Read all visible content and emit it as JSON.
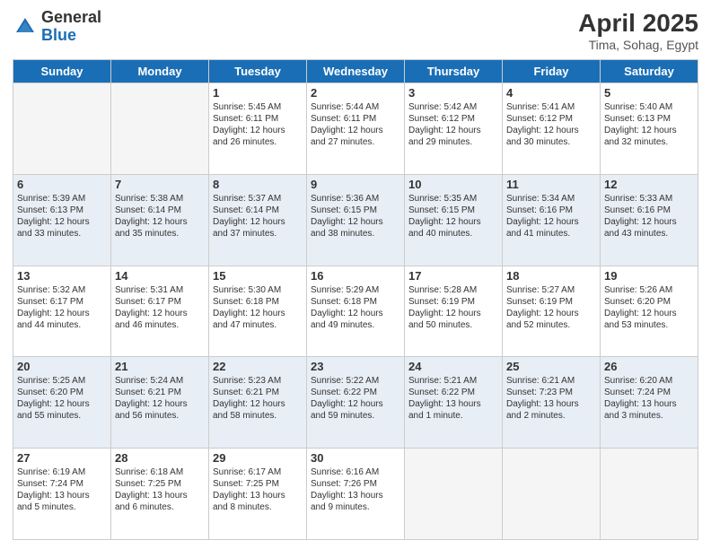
{
  "header": {
    "logo_general": "General",
    "logo_blue": "Blue",
    "month_title": "April 2025",
    "location": "Tima, Sohag, Egypt"
  },
  "days_of_week": [
    "Sunday",
    "Monday",
    "Tuesday",
    "Wednesday",
    "Thursday",
    "Friday",
    "Saturday"
  ],
  "weeks": [
    {
      "days": [
        {
          "num": "",
          "info": ""
        },
        {
          "num": "",
          "info": ""
        },
        {
          "num": "1",
          "info": "Sunrise: 5:45 AM\nSunset: 6:11 PM\nDaylight: 12 hours and 26 minutes."
        },
        {
          "num": "2",
          "info": "Sunrise: 5:44 AM\nSunset: 6:11 PM\nDaylight: 12 hours and 27 minutes."
        },
        {
          "num": "3",
          "info": "Sunrise: 5:42 AM\nSunset: 6:12 PM\nDaylight: 12 hours and 29 minutes."
        },
        {
          "num": "4",
          "info": "Sunrise: 5:41 AM\nSunset: 6:12 PM\nDaylight: 12 hours and 30 minutes."
        },
        {
          "num": "5",
          "info": "Sunrise: 5:40 AM\nSunset: 6:13 PM\nDaylight: 12 hours and 32 minutes."
        }
      ]
    },
    {
      "days": [
        {
          "num": "6",
          "info": "Sunrise: 5:39 AM\nSunset: 6:13 PM\nDaylight: 12 hours and 33 minutes."
        },
        {
          "num": "7",
          "info": "Sunrise: 5:38 AM\nSunset: 6:14 PM\nDaylight: 12 hours and 35 minutes."
        },
        {
          "num": "8",
          "info": "Sunrise: 5:37 AM\nSunset: 6:14 PM\nDaylight: 12 hours and 37 minutes."
        },
        {
          "num": "9",
          "info": "Sunrise: 5:36 AM\nSunset: 6:15 PM\nDaylight: 12 hours and 38 minutes."
        },
        {
          "num": "10",
          "info": "Sunrise: 5:35 AM\nSunset: 6:15 PM\nDaylight: 12 hours and 40 minutes."
        },
        {
          "num": "11",
          "info": "Sunrise: 5:34 AM\nSunset: 6:16 PM\nDaylight: 12 hours and 41 minutes."
        },
        {
          "num": "12",
          "info": "Sunrise: 5:33 AM\nSunset: 6:16 PM\nDaylight: 12 hours and 43 minutes."
        }
      ]
    },
    {
      "days": [
        {
          "num": "13",
          "info": "Sunrise: 5:32 AM\nSunset: 6:17 PM\nDaylight: 12 hours and 44 minutes."
        },
        {
          "num": "14",
          "info": "Sunrise: 5:31 AM\nSunset: 6:17 PM\nDaylight: 12 hours and 46 minutes."
        },
        {
          "num": "15",
          "info": "Sunrise: 5:30 AM\nSunset: 6:18 PM\nDaylight: 12 hours and 47 minutes."
        },
        {
          "num": "16",
          "info": "Sunrise: 5:29 AM\nSunset: 6:18 PM\nDaylight: 12 hours and 49 minutes."
        },
        {
          "num": "17",
          "info": "Sunrise: 5:28 AM\nSunset: 6:19 PM\nDaylight: 12 hours and 50 minutes."
        },
        {
          "num": "18",
          "info": "Sunrise: 5:27 AM\nSunset: 6:19 PM\nDaylight: 12 hours and 52 minutes."
        },
        {
          "num": "19",
          "info": "Sunrise: 5:26 AM\nSunset: 6:20 PM\nDaylight: 12 hours and 53 minutes."
        }
      ]
    },
    {
      "days": [
        {
          "num": "20",
          "info": "Sunrise: 5:25 AM\nSunset: 6:20 PM\nDaylight: 12 hours and 55 minutes."
        },
        {
          "num": "21",
          "info": "Sunrise: 5:24 AM\nSunset: 6:21 PM\nDaylight: 12 hours and 56 minutes."
        },
        {
          "num": "22",
          "info": "Sunrise: 5:23 AM\nSunset: 6:21 PM\nDaylight: 12 hours and 58 minutes."
        },
        {
          "num": "23",
          "info": "Sunrise: 5:22 AM\nSunset: 6:22 PM\nDaylight: 12 hours and 59 minutes."
        },
        {
          "num": "24",
          "info": "Sunrise: 5:21 AM\nSunset: 6:22 PM\nDaylight: 13 hours and 1 minute."
        },
        {
          "num": "25",
          "info": "Sunrise: 6:21 AM\nSunset: 7:23 PM\nDaylight: 13 hours and 2 minutes."
        },
        {
          "num": "26",
          "info": "Sunrise: 6:20 AM\nSunset: 7:24 PM\nDaylight: 13 hours and 3 minutes."
        }
      ]
    },
    {
      "days": [
        {
          "num": "27",
          "info": "Sunrise: 6:19 AM\nSunset: 7:24 PM\nDaylight: 13 hours and 5 minutes."
        },
        {
          "num": "28",
          "info": "Sunrise: 6:18 AM\nSunset: 7:25 PM\nDaylight: 13 hours and 6 minutes."
        },
        {
          "num": "29",
          "info": "Sunrise: 6:17 AM\nSunset: 7:25 PM\nDaylight: 13 hours and 8 minutes."
        },
        {
          "num": "30",
          "info": "Sunrise: 6:16 AM\nSunset: 7:26 PM\nDaylight: 13 hours and 9 minutes."
        },
        {
          "num": "",
          "info": ""
        },
        {
          "num": "",
          "info": ""
        },
        {
          "num": "",
          "info": ""
        }
      ]
    }
  ]
}
